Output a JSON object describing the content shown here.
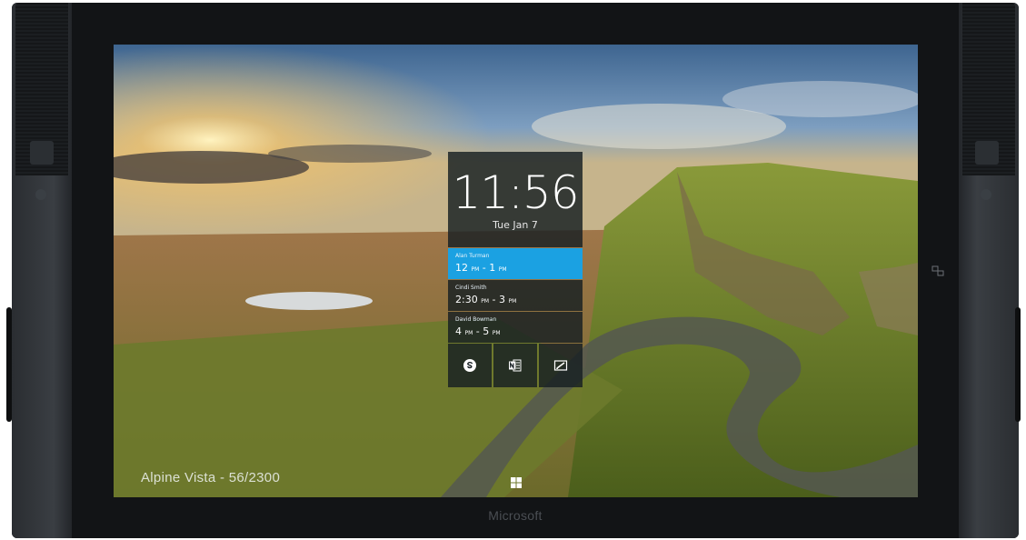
{
  "device": {
    "brand": "Microsoft"
  },
  "wallpaper": {
    "title": "Alpine Vista - 56/2300"
  },
  "lockscreen": {
    "time": "11:56",
    "date": "Tue Jan 7",
    "appointments": [
      {
        "name": "Alan Turman",
        "start": "12",
        "start_ampm": "PM",
        "end": "1",
        "end_ampm": "PM",
        "highlight": true
      },
      {
        "name": "Cindi Smith",
        "start": "2:30",
        "start_ampm": "PM",
        "end": "3",
        "end_ampm": "PM",
        "highlight": false
      },
      {
        "name": "David Bowman",
        "start": "4",
        "start_ampm": "PM",
        "end": "5",
        "end_ampm": "PM",
        "highlight": false
      }
    ],
    "apps": [
      {
        "icon": "skype-icon"
      },
      {
        "icon": "onenote-icon"
      },
      {
        "icon": "whiteboard-icon"
      }
    ]
  },
  "colors": {
    "accent": "#1ba1e2",
    "tile": "#161e22",
    "bezel": "#121416"
  }
}
